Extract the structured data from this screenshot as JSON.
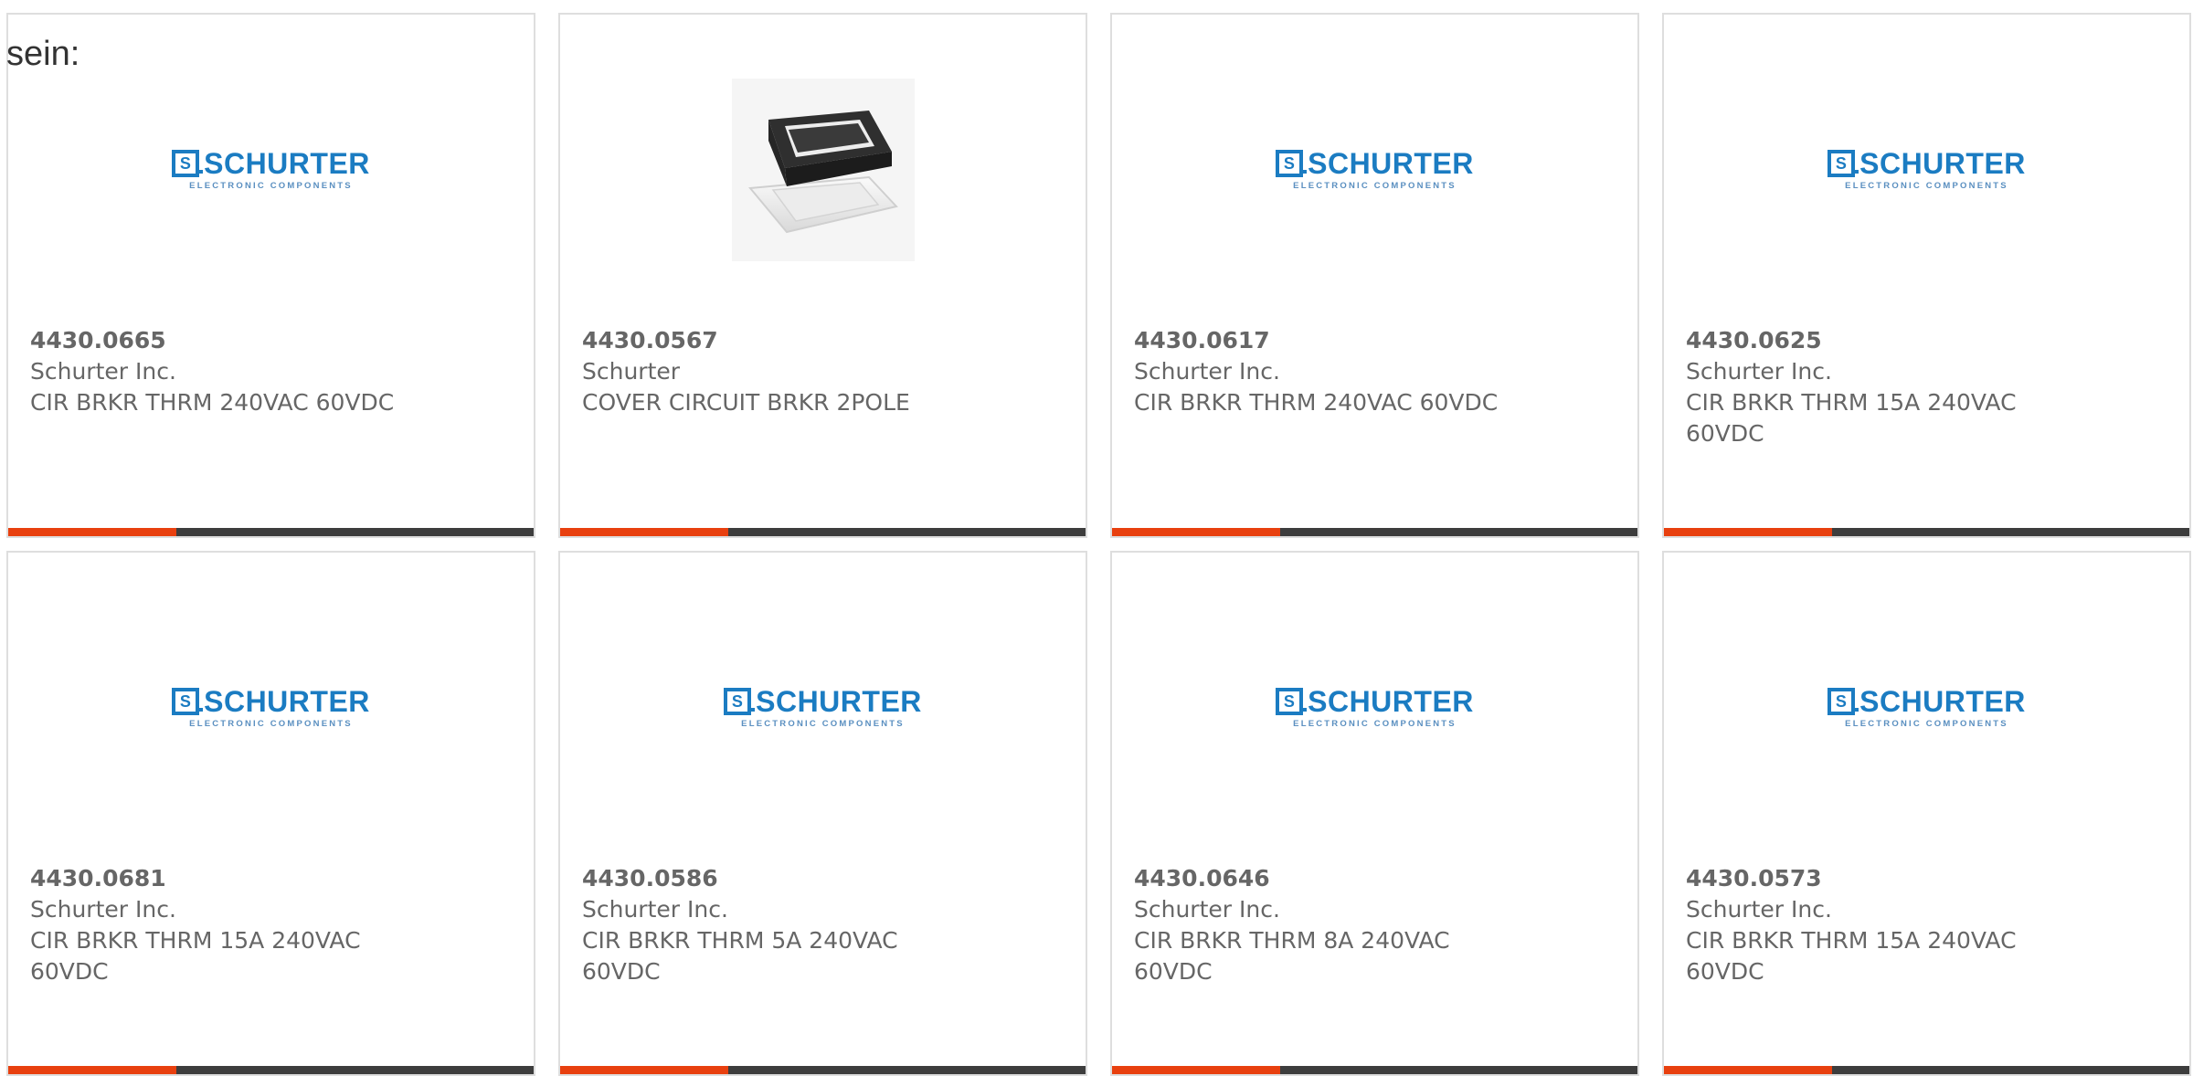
{
  "intro_text": "sein:",
  "logo": {
    "brand": "SCHURTER",
    "mark": "S",
    "tagline": "ELECTRONIC COMPONENTS"
  },
  "colors": {
    "brand_blue": "#1b7cc2",
    "accent_orange": "#e8400f",
    "bar_dark": "#3d3d3d",
    "text_gray": "#666666"
  },
  "card_progress_fraction": 0.32,
  "products": [
    {
      "part_number": "4430.0665",
      "manufacturer": "Schurter Inc.",
      "description": "CIR BRKR THRM 240VAC 60VDC",
      "image": "schurter-logo"
    },
    {
      "part_number": "4430.0567",
      "manufacturer": "Schurter",
      "description": "COVER CIRCUIT BRKR 2POLE",
      "image": "product-photo"
    },
    {
      "part_number": "4430.0617",
      "manufacturer": "Schurter Inc.",
      "description": "CIR BRKR THRM 240VAC 60VDC",
      "image": "schurter-logo"
    },
    {
      "part_number": "4430.0625",
      "manufacturer": "Schurter Inc.",
      "description": "CIR BRKR THRM 15A 240VAC 60VDC",
      "image": "schurter-logo"
    },
    {
      "part_number": "4430.0681",
      "manufacturer": "Schurter Inc.",
      "description": "CIR BRKR THRM 15A 240VAC 60VDC",
      "image": "schurter-logo"
    },
    {
      "part_number": "4430.0586",
      "manufacturer": "Schurter Inc.",
      "description": "CIR BRKR THRM 5A 240VAC 60VDC",
      "image": "schurter-logo"
    },
    {
      "part_number": "4430.0646",
      "manufacturer": "Schurter Inc.",
      "description": "CIR BRKR THRM 8A 240VAC 60VDC",
      "image": "schurter-logo"
    },
    {
      "part_number": "4430.0573",
      "manufacturer": "Schurter Inc.",
      "description": "CIR BRKR THRM 15A 240VAC 60VDC",
      "image": "schurter-logo"
    }
  ]
}
